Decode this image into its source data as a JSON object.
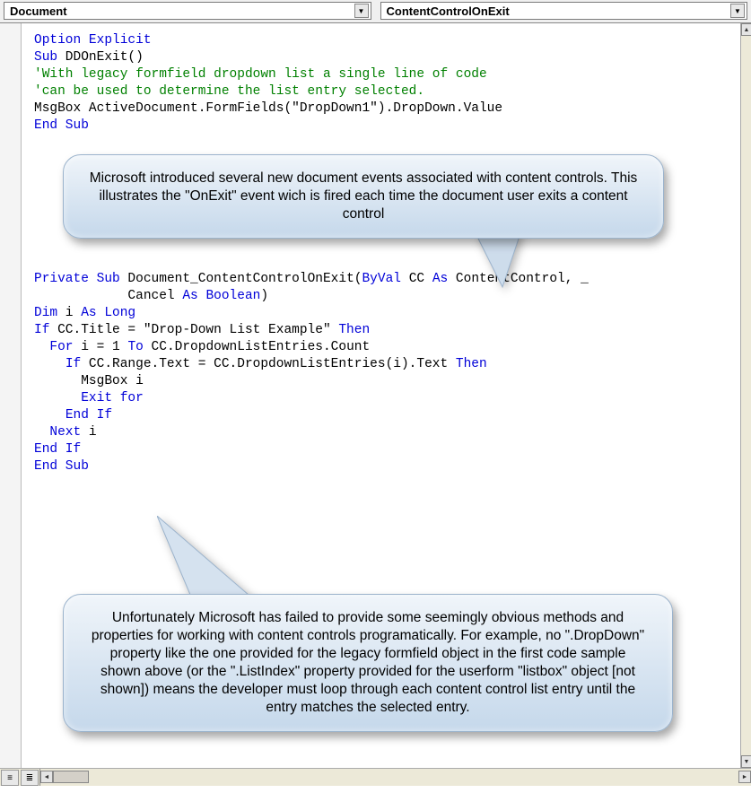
{
  "dropdowns": {
    "object": "Document",
    "procedure": "ContentControlOnExit"
  },
  "code": {
    "l1a": "Option",
    "l1b": " Explicit",
    "l2a": "Sub",
    "l2b": " DDOnExit()",
    "l3": "'With legacy formfield dropdown list a single line of code",
    "l4": "'can be used to determine the list entry selected.",
    "l5": "MsgBox ActiveDocument.FormFields(\"DropDown1\").DropDown.Value",
    "l6": "End Sub",
    "l7a": "Private",
    "l7b": " ",
    "l7c": "Sub",
    "l7d": " Document_ContentControlOnExit(",
    "l7e": "ByVal",
    "l7f": " CC ",
    "l7g": "As",
    "l7h": " ContentControl, _",
    "l8a": "            Cancel ",
    "l8b": "As",
    "l8c": " ",
    "l8d": "Boolean",
    "l8e": ")",
    "l9a": "Dim",
    "l9b": " i ",
    "l9c": "As",
    "l9d": " ",
    "l9e": "Long",
    "l10a": "If",
    "l10b": " CC.Title = \"Drop-Down List Example\" ",
    "l10c": "Then",
    "l11a": "  ",
    "l11b": "For",
    "l11c": " i = 1 ",
    "l11d": "To",
    "l11e": " CC.DropdownListEntries.Count",
    "l12a": "    ",
    "l12b": "If",
    "l12c": " CC.Range.Text = CC.DropdownListEntries(i).Text ",
    "l12d": "Then",
    "l13": "      MsgBox i",
    "l14a": "      ",
    "l14b": "Exit for",
    "l15a": "    ",
    "l15b": "End If",
    "l16a": "  ",
    "l16b": "Next",
    "l16c": " i",
    "l17": "End If",
    "l18": "End Sub"
  },
  "callouts": {
    "c1": "Microsoft introduced several new document events associated with content controls.  This illustrates the \"OnExit\" event wich is fired each time the document user exits a content control",
    "c2": "Unfortunately Microsoft has failed to provide some seemingly obvious methods and properties for working with content controls programatically.  For example, no \".DropDown\" property like the one provided for the legacy formfield object in the first code sample shown above (or the \".ListIndex\" property provided for the userform \"listbox\" object [not shown]) means the developer must loop through each content control list entry until the entry matches the selected entry."
  },
  "view_icons": {
    "a": "≡",
    "b": "≣"
  }
}
